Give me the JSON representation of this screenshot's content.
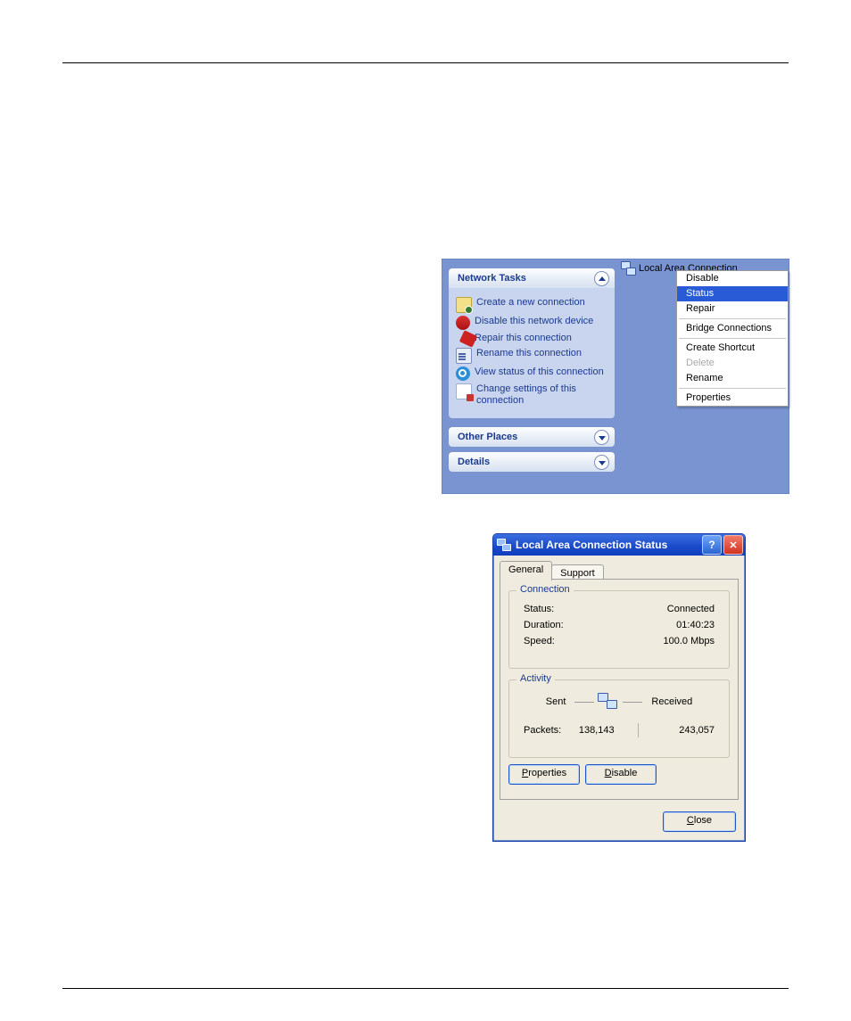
{
  "tasks_panel": {
    "title": "Network Tasks",
    "items": [
      {
        "label": "Create a new connection"
      },
      {
        "label": "Disable this network device"
      },
      {
        "label": "Repair this connection"
      },
      {
        "label": "Rename this connection"
      },
      {
        "label": "View status of this connection"
      },
      {
        "label": "Change settings of this connection"
      }
    ],
    "other_places": "Other Places",
    "details": "Details"
  },
  "lan_icon_label": "Local Area Connection",
  "ctx_menu": {
    "disable": "Disable",
    "status": "Status",
    "repair": "Repair",
    "bridge": "Bridge Connections",
    "shortcut": "Create Shortcut",
    "delete": "Delete",
    "rename": "Rename",
    "properties": "Properties"
  },
  "dialog": {
    "title": "Local Area Connection Status",
    "tabs": {
      "general": "General",
      "support": "Support"
    },
    "group_connection": "Connection",
    "group_activity": "Activity",
    "status_k": "Status:",
    "status_v": "Connected",
    "duration_k": "Duration:",
    "duration_v": "01:40:23",
    "speed_k": "Speed:",
    "speed_v": "100.0 Mbps",
    "sent": "Sent",
    "received": "Received",
    "packets_k": "Packets:",
    "packets_sent": "138,143",
    "packets_recv": "243,057",
    "btn_properties_u": "P",
    "btn_properties_r": "roperties",
    "btn_disable_u": "D",
    "btn_disable_r": "isable",
    "btn_close_u": "C",
    "btn_close_r": "lose"
  }
}
